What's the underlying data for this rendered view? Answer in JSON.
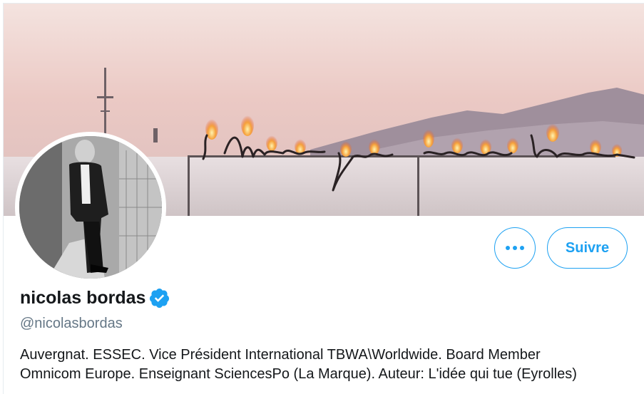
{
  "banner": {
    "alt": "I Wish you were here"
  },
  "profile": {
    "name": "nicolas bordas",
    "handle": "@nicolasbordas",
    "verified": true,
    "bio_line1": "Auvergnat. ESSEC. Vice Président International TBWA\\Worldwide. Board Member",
    "bio_line2": "Omnicom Europe. Enseignant SciencesPo (La Marque). Auteur: L'idée qui tue (Eyrolles)"
  },
  "actions": {
    "more_label": "•••",
    "follow_label": "Suivre"
  },
  "icons": {
    "verified": "verified-badge-icon",
    "more": "more-dots-icon"
  },
  "colors": {
    "accent": "#1da1f2",
    "text": "#14171a",
    "muted": "#657786"
  }
}
